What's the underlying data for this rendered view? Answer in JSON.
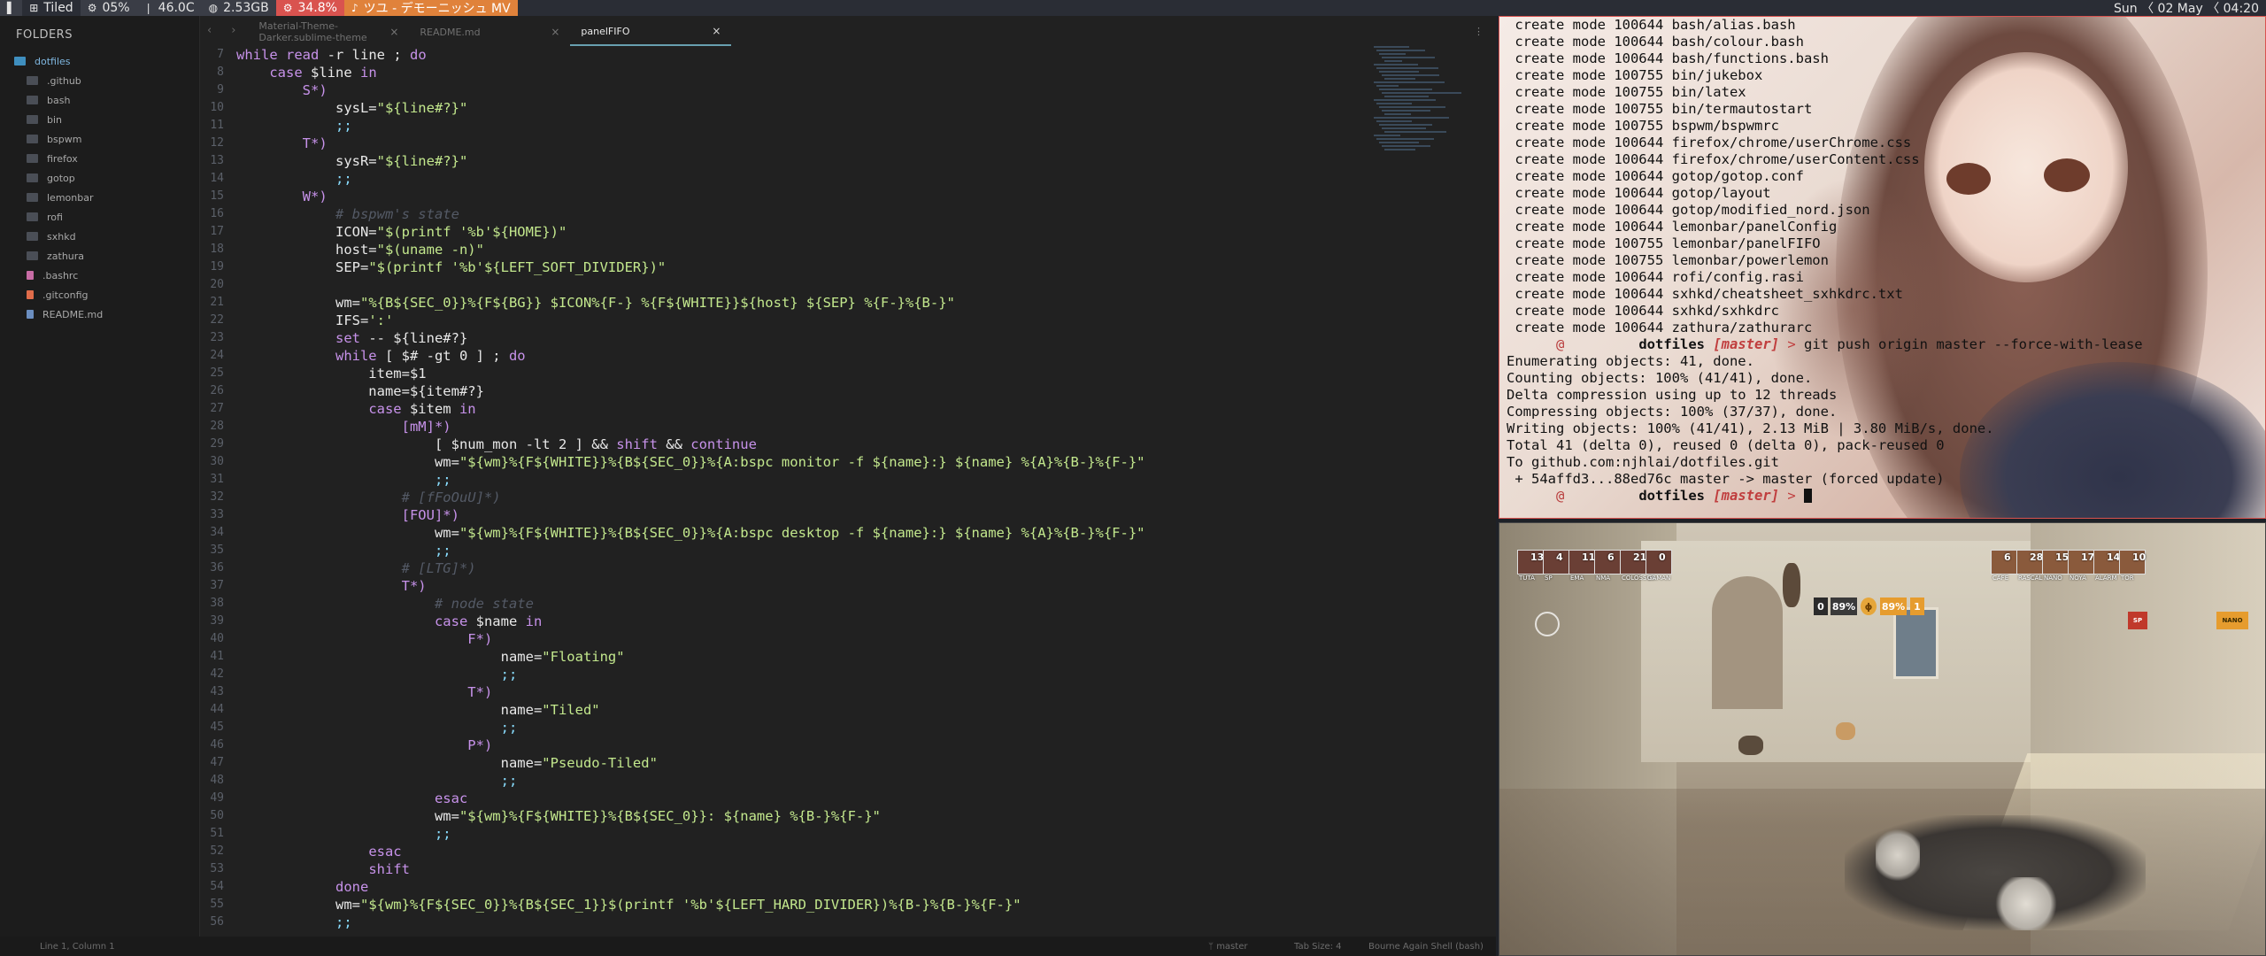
{
  "topbar": {
    "layout": "Tiled",
    "cpu": "05%",
    "temp": "46.0C",
    "mem": "2.53GB",
    "battery": "34.8%",
    "music": "ツユ - デモーニッシュ MV",
    "date": "Sun 〈 02 May 〈 04:20"
  },
  "sidebar": {
    "title": "FOLDERS",
    "root": "dotfiles",
    "items": [
      {
        "label": ".github",
        "type": "folder"
      },
      {
        "label": "bash",
        "type": "folder"
      },
      {
        "label": "bin",
        "type": "folder"
      },
      {
        "label": "bspwm",
        "type": "folder"
      },
      {
        "label": "firefox",
        "type": "folder"
      },
      {
        "label": "gotop",
        "type": "folder"
      },
      {
        "label": "lemonbar",
        "type": "folder"
      },
      {
        "label": "rofi",
        "type": "folder"
      },
      {
        "label": "sxhkd",
        "type": "folder"
      },
      {
        "label": "zathura",
        "type": "folder"
      },
      {
        "label": ".bashrc",
        "type": "bash"
      },
      {
        "label": ".gitconfig",
        "type": "git"
      },
      {
        "label": "README.md",
        "type": "md"
      }
    ]
  },
  "tabs": [
    {
      "label": "Material-Theme-Darker.sublime-theme",
      "active": false
    },
    {
      "label": "README.md",
      "active": false
    },
    {
      "label": "panelFIFO",
      "active": true
    }
  ],
  "code_lines": [
    {
      "n": "7",
      "html": "<span class=\"kw\">while</span> <span class=\"kw\">read</span> -r line ; <span class=\"kw\">do</span>"
    },
    {
      "n": "8",
      "html": "    <span class=\"kw\">case</span> $line <span class=\"kw\">in</span>"
    },
    {
      "n": "9",
      "html": "        <span class=\"pat\">S*)</span>"
    },
    {
      "n": "10",
      "html": "            sysL=<span class=\"str\">\"${line#?}\"</span>"
    },
    {
      "n": "11",
      "html": "            <span class=\"op\">;;</span>"
    },
    {
      "n": "12",
      "html": "        <span class=\"pat\">T*)</span>"
    },
    {
      "n": "13",
      "html": "            sysR=<span class=\"str\">\"${line#?}\"</span>"
    },
    {
      "n": "14",
      "html": "            <span class=\"op\">;;</span>"
    },
    {
      "n": "15",
      "html": "        <span class=\"pat\">W*)</span>"
    },
    {
      "n": "16",
      "html": "            <span class=\"cm\"># bspwm's state</span>"
    },
    {
      "n": "17",
      "html": "            ICON=<span class=\"str\">\"$(printf '%b'${HOME})\"</span>"
    },
    {
      "n": "18",
      "html": "            host=<span class=\"str\">\"$(uname -n)\"</span>"
    },
    {
      "n": "19",
      "html": "            SEP=<span class=\"str\">\"$(printf '%b'${LEFT_SOFT_DIVIDER})\"</span>"
    },
    {
      "n": "20",
      "html": ""
    },
    {
      "n": "21",
      "html": "            wm=<span class=\"str\">\"%{B${SEC_0}}%{F${BG}} $ICON%{F-} %{F${WHITE}}${host} ${SEP} %{F-}%{B-}\"</span>"
    },
    {
      "n": "22",
      "html": "            IFS=<span class=\"str\">':'</span>"
    },
    {
      "n": "23",
      "html": "            <span class=\"kw\">set</span> -- ${line#?}"
    },
    {
      "n": "24",
      "html": "            <span class=\"kw\">while</span> [ $# -gt 0 ] ; <span class=\"kw\">do</span>"
    },
    {
      "n": "25",
      "html": "                item=$1"
    },
    {
      "n": "26",
      "html": "                name=${item#?}"
    },
    {
      "n": "27",
      "html": "                <span class=\"kw\">case</span> $item <span class=\"kw\">in</span>"
    },
    {
      "n": "28",
      "html": "                    <span class=\"pat\">[mM]*)</span>"
    },
    {
      "n": "29",
      "html": "                        [ $num_mon -lt 2 ] &amp;&amp; <span class=\"kw\">shift</span> &amp;&amp; <span class=\"kw\">continue</span>"
    },
    {
      "n": "30",
      "html": "                        wm=<span class=\"str\">\"${wm}%{F${WHITE}}%{B${SEC_0}}%{A:bspc monitor -f ${name}:} ${name} %{A}%{B-}%{F-}\"</span>"
    },
    {
      "n": "31",
      "html": "                        <span class=\"op\">;;</span>"
    },
    {
      "n": "32",
      "html": "                    <span class=\"cm\"># [fFoOuU]*)</span>"
    },
    {
      "n": "33",
      "html": "                    <span class=\"pat\">[FOU]*)</span>"
    },
    {
      "n": "34",
      "html": "                        wm=<span class=\"str\">\"${wm}%{F${WHITE}}%{B${SEC_0}}%{A:bspc desktop -f ${name}:} ${name} %{A}%{B-}%{F-}\"</span>"
    },
    {
      "n": "35",
      "html": "                        <span class=\"op\">;;</span>"
    },
    {
      "n": "36",
      "html": "                    <span class=\"cm\"># [LTG]*)</span>"
    },
    {
      "n": "37",
      "html": "                    <span class=\"pat\">T*)</span>"
    },
    {
      "n": "38",
      "html": "                        <span class=\"cm\"># node state</span>"
    },
    {
      "n": "39",
      "html": "                        <span class=\"kw\">case</span> $name <span class=\"kw\">in</span>"
    },
    {
      "n": "40",
      "html": "                            <span class=\"pat\">F*)</span>"
    },
    {
      "n": "41",
      "html": "                                name=<span class=\"str\">\"Floating\"</span>"
    },
    {
      "n": "42",
      "html": "                                <span class=\"op\">;;</span>"
    },
    {
      "n": "43",
      "html": "                            <span class=\"pat\">T*)</span>"
    },
    {
      "n": "44",
      "html": "                                name=<span class=\"str\">\"Tiled\"</span>"
    },
    {
      "n": "45",
      "html": "                                <span class=\"op\">;;</span>"
    },
    {
      "n": "46",
      "html": "                            <span class=\"pat\">P*)</span>"
    },
    {
      "n": "47",
      "html": "                                name=<span class=\"str\">\"Pseudo-Tiled\"</span>"
    },
    {
      "n": "48",
      "html": "                                <span class=\"op\">;;</span>"
    },
    {
      "n": "49",
      "html": "                        <span class=\"kw\">esac</span>"
    },
    {
      "n": "50",
      "html": "                        wm=<span class=\"str\">\"${wm}%{F${WHITE}}%{B${SEC_0}}: ${name} %{B-}%{F-}\"</span>"
    },
    {
      "n": "51",
      "html": "                        <span class=\"op\">;;</span>"
    },
    {
      "n": "52",
      "html": "                <span class=\"kw\">esac</span>"
    },
    {
      "n": "53",
      "html": "                <span class=\"kw\">shift</span>"
    },
    {
      "n": "54",
      "html": "            <span class=\"kw\">done</span>"
    },
    {
      "n": "55",
      "html": "            wm=<span class=\"str\">\"${wm}%{F${SEC_0}}%{B${SEC_1}}$(printf '%b'${LEFT_HARD_DIVIDER})%{B-}%{B-}%{F-}\"</span>"
    },
    {
      "n": "56",
      "html": "            <span class=\"op\">;;</span>"
    }
  ],
  "statusbar": {
    "position": "Line 1, Column 1",
    "branch": "master",
    "tab_size": "Tab Size: 4",
    "syntax": "Bourne Again Shell (bash)"
  },
  "terminal": {
    "create_lines": [
      "create mode 100644 bash/alias.bash",
      "create mode 100644 bash/colour.bash",
      "create mode 100644 bash/functions.bash",
      "create mode 100755 bin/jukebox",
      "create mode 100755 bin/latex",
      "create mode 100755 bin/termautostart",
      "create mode 100755 bspwm/bspwmrc",
      "create mode 100644 firefox/chrome/userChrome.css",
      "create mode 100644 firefox/chrome/userContent.css",
      "create mode 100644 gotop/gotop.conf",
      "create mode 100644 gotop/layout",
      "create mode 100644 gotop/modified_nord.json",
      "create mode 100644 lemonbar/panelConfig",
      "create mode 100755 lemonbar/panelFIFO",
      "create mode 100755 lemonbar/powerlemon",
      "create mode 100644 rofi/config.rasi",
      "create mode 100644 sxhkd/cheatsheet_sxhkdrc.txt",
      "create mode 100644 sxhkd/sxhkdrc",
      "create mode 100644 zathura/zathurarc"
    ],
    "prompt_at": "@",
    "prompt_dir": "dotfiles",
    "prompt_branch": "[master]",
    "prompt_arrow": ">",
    "command": "git push origin master --force-with-lease",
    "output_lines": [
      "Enumerating objects: 41, done.",
      "Counting objects: 100% (41/41), done.",
      "Delta compression using up to 12 threads",
      "Compressing objects: 100% (37/37), done.",
      "Writing objects: 100% (41/41), 2.13 MiB | 3.80 MiB/s, done.",
      "Total 41 (delta 0), reused 0 (delta 0), pack-reused 0",
      "To github.com:njhlai/dotfiles.git",
      " + 54affd3...88ed76c master -> master (forced update)"
    ]
  },
  "game": {
    "team_left": [
      {
        "num": "13",
        "name": "TUTA"
      },
      {
        "num": "4",
        "name": "SP"
      },
      {
        "num": "11",
        "name": "EMA"
      },
      {
        "num": "6",
        "name": "NMA"
      },
      {
        "num": "21",
        "name": "COLOSSUS"
      },
      {
        "num": "0",
        "name": "GAMAN"
      }
    ],
    "team_right": [
      {
        "num": "6",
        "name": "CAFE"
      },
      {
        "num": "28",
        "name": "RASCAL"
      },
      {
        "num": "15",
        "name": "NANO"
      },
      {
        "num": "17",
        "name": "NOYA"
      },
      {
        "num": "14",
        "name": "ALARM"
      },
      {
        "num": "10",
        "name": "TOR"
      }
    ],
    "objective": {
      "left_count": "0",
      "left_pct": "89%",
      "right_pct": "89%",
      "right_count": "1"
    },
    "mini_left": "SP",
    "mini_right": "NANO"
  }
}
